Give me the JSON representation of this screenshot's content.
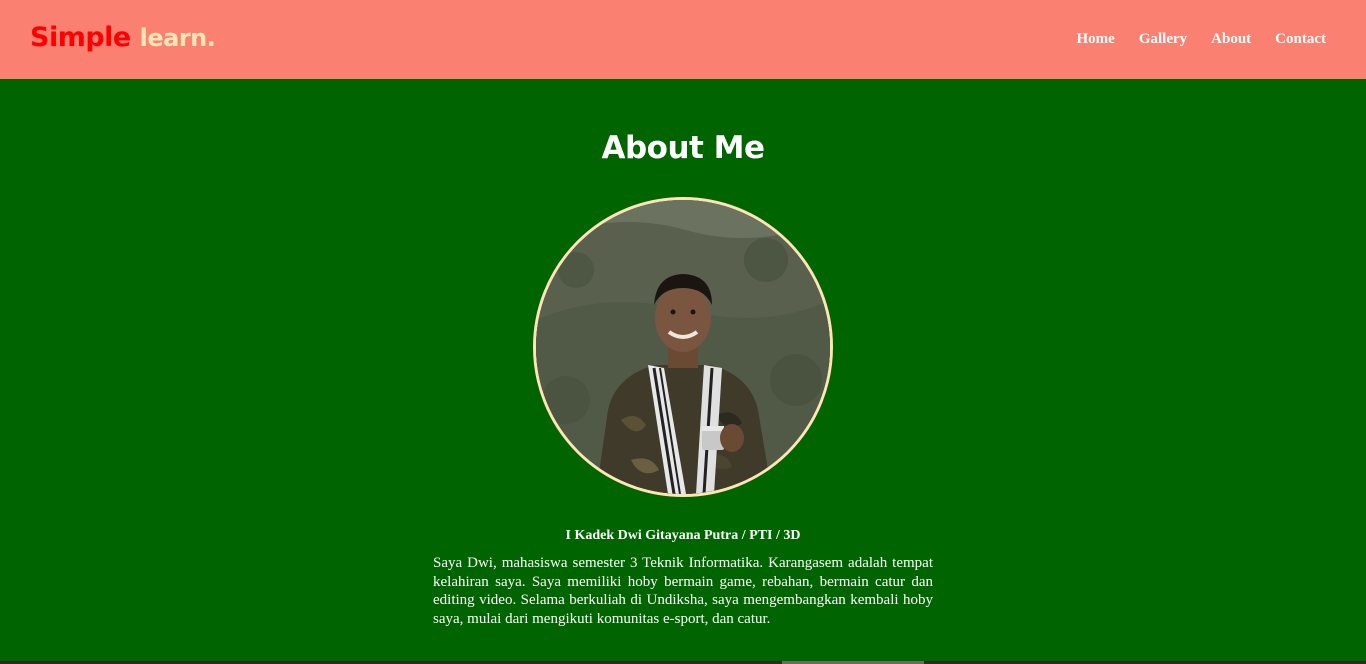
{
  "brand": {
    "main": "Simple",
    "sub": "learn."
  },
  "nav": {
    "items": [
      {
        "label": "Home"
      },
      {
        "label": "Gallery"
      },
      {
        "label": "About"
      },
      {
        "label": "Contact"
      }
    ]
  },
  "about": {
    "title": "About Me",
    "photo_icon": "profile-photo",
    "name_line": "I Kadek Dwi Gitayana Putra / PTI / 3D",
    "bio": "Saya Dwi, mahasiswa semester 3 Teknik Informatika. Karangasem adalah tempat kelahiran saya. Saya memiliki hoby bermain game, rebahan, bermain catur dan editing video. Selama berkuliah di Undiksha, saya mengembangkan kembali hoby saya, mulai dari mengikuti komunitas e-sport, dan catur."
  },
  "colors": {
    "navbar_bg": "#fa8072",
    "page_bg": "#006400",
    "brand_main": "#ff0000",
    "brand_sub": "#ffe4b5",
    "photo_border": "#ffe4b5",
    "text": "#ffffff"
  }
}
